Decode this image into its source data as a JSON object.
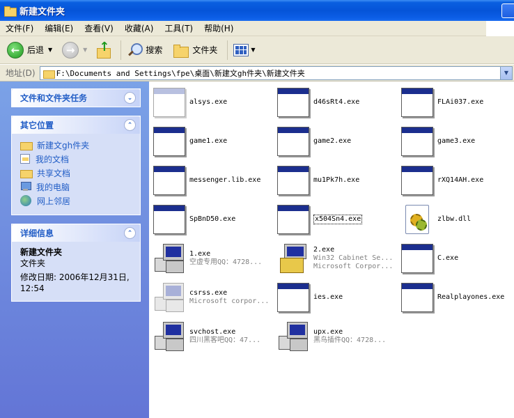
{
  "window": {
    "title": "新建文件夹"
  },
  "menu": [
    "文件(F)",
    "编辑(E)",
    "查看(V)",
    "收藏(A)",
    "工具(T)",
    "帮助(H)"
  ],
  "toolbar": {
    "back": "后退",
    "search": "搜索",
    "folders": "文件夹"
  },
  "address": {
    "label": "地址(D)",
    "path": "F:\\Documents and Settings\\fpe\\桌面\\新建文gh件夹\\新建文件夹"
  },
  "taskpane": {
    "tasks_title": "文件和文件夹任务",
    "places_title": "其它位置",
    "places": [
      {
        "label": "新建文gh件夹",
        "icon": "folder-icon"
      },
      {
        "label": "我的文档",
        "icon": "my-documents-icon"
      },
      {
        "label": "共享文档",
        "icon": "folder-icon"
      },
      {
        "label": "我的电脑",
        "icon": "my-computer-icon"
      },
      {
        "label": "网上邻居",
        "icon": "network-icon"
      }
    ],
    "details_title": "详细信息",
    "details": {
      "name": "新建文件夹",
      "type": "文件夹",
      "modified": "修改日期: 2006年12月31日,",
      "modified_time": "12:54"
    }
  },
  "files": [
    {
      "name": "alsys.exe",
      "icon": "exe-faded"
    },
    {
      "name": "d46sRt4.exe",
      "icon": "exe"
    },
    {
      "name": "FLAi037.exe",
      "icon": "exe"
    },
    {
      "name": "game1.exe",
      "icon": "exe"
    },
    {
      "name": "game2.exe",
      "icon": "exe"
    },
    {
      "name": "game3.exe",
      "icon": "exe"
    },
    {
      "name": "messenger.lib.exe",
      "icon": "exe"
    },
    {
      "name": "mu1Pk7h.exe",
      "icon": "exe"
    },
    {
      "name": "rXQ14AH.exe",
      "icon": "exe"
    },
    {
      "name": "SpBnD50.exe",
      "icon": "exe"
    },
    {
      "name": "x504Sn4.exe",
      "icon": "exe",
      "selected": true
    },
    {
      "name": "zlbw.dll",
      "icon": "dll"
    },
    {
      "name": "1.exe",
      "sub": "空虚专用QQ：4728...",
      "icon": "pc"
    },
    {
      "name": "2.exe",
      "sub": "Win32 Cabinet Se...",
      "sub2": "Microsoft Corpor...",
      "icon": "box"
    },
    {
      "name": "C.exe",
      "icon": "exe"
    },
    {
      "name": "csrss.exe",
      "sub": "Microsoft corpor...",
      "icon": "pc-faded"
    },
    {
      "name": "ies.exe",
      "icon": "exe"
    },
    {
      "name": "Realplayones.exe",
      "icon": "exe"
    },
    {
      "name": "svchost.exe",
      "sub": "四川黑客吧QQ：47...",
      "icon": "pc"
    },
    {
      "name": "upx.exe",
      "sub": "黑鸟插件QQ：4728...",
      "icon": "pc"
    }
  ]
}
